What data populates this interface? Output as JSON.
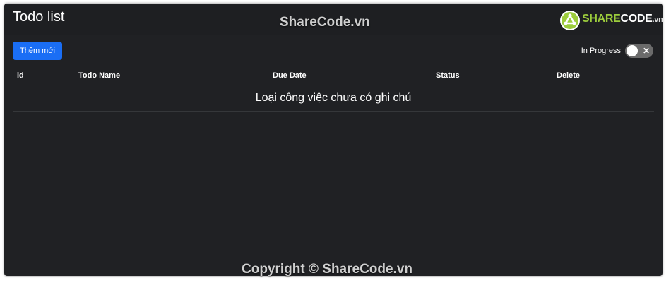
{
  "app": {
    "title": "Todo list"
  },
  "watermark": {
    "top": "ShareCode.vn",
    "bottom": "Copyright © ShareCode.vn"
  },
  "logo": {
    "part1": "SHARE",
    "part2": "CODE",
    "part3": ".vn",
    "icon": "sharecode-logo-icon"
  },
  "toolbar": {
    "add_label": "Thêm mới",
    "toggle_label": "In Progress",
    "toggle_icon": "close-icon",
    "toggle_checked": false
  },
  "table": {
    "columns": [
      "id",
      "Todo Name",
      "Due Date",
      "Status",
      "Delete"
    ],
    "empty_message": "Loại công việc chưa có ghi chú"
  },
  "colors": {
    "background": "#202124",
    "primary_button": "#1a6ef5",
    "toggle_off": "#6b6b6b",
    "logo_green": "#9ccc3c"
  }
}
